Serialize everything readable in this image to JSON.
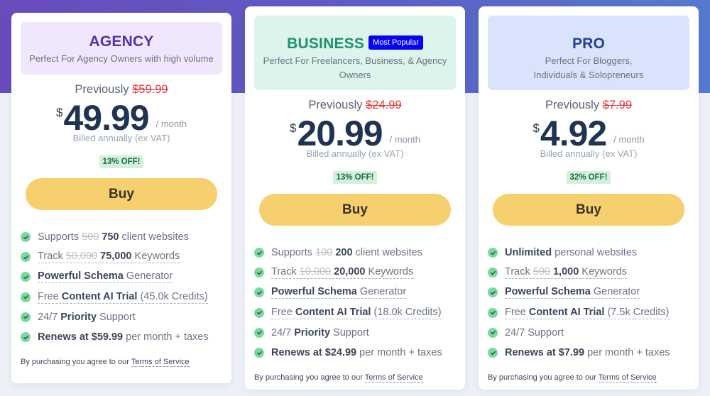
{
  "colors": {
    "hero_gradient_start": "#6a4bbd",
    "hero_gradient_end": "#557ad0",
    "buy_button": "#f6cf6e",
    "popular_badge": "#0505f0",
    "old_price": "#e23b3b",
    "check": "#7dd7a1",
    "off_badge_bg": "#d3f0dc"
  },
  "plans": [
    {
      "id": "agency",
      "title": "AGENCY",
      "badge": null,
      "description": "Perfect For Agency Owners with high volume",
      "previously_label": "Previously",
      "previous_price": "$59.99",
      "currency": "$",
      "price": "49.99",
      "period": "/ month",
      "billing": "Billed annually (ex VAT)",
      "discount": "13% OFF!",
      "buy_label": "Buy",
      "features": [
        {
          "icon": "check-circle-icon",
          "parts": [
            {
              "t": "Supports "
            },
            {
              "t": "500",
              "s": true
            },
            {
              "t": " "
            },
            {
              "t": "750",
              "b": true
            },
            {
              "t": " client websites"
            }
          ],
          "underline": false
        },
        {
          "icon": "check-circle-icon",
          "parts": [
            {
              "t": "Track "
            },
            {
              "t": "50,000",
              "s": true
            },
            {
              "t": " "
            },
            {
              "t": "75,000",
              "b": true
            },
            {
              "t": " Keywords"
            }
          ],
          "underline": true
        },
        {
          "icon": "check-circle-icon",
          "parts": [
            {
              "t": "Powerful Schema",
              "b": true
            },
            {
              "t": " Generator"
            }
          ],
          "underline": true
        },
        {
          "icon": "check-circle-icon",
          "parts": [
            {
              "t": "Free "
            },
            {
              "t": "Content AI Trial",
              "b": true
            },
            {
              "t": " (45.0k Credits)"
            }
          ],
          "underline": true
        },
        {
          "icon": "check-circle-icon",
          "parts": [
            {
              "t": "24/7 "
            },
            {
              "t": "Priority",
              "b": true
            },
            {
              "t": " Support"
            }
          ],
          "underline": false
        },
        {
          "icon": "check-circle-icon",
          "parts": [
            {
              "t": "Renews at $59.99",
              "b": true
            },
            {
              "t": " per month + taxes"
            }
          ],
          "underline": false
        }
      ],
      "terms_prefix": "By purchasing you agree to our ",
      "terms_link": "Terms of Service"
    },
    {
      "id": "business",
      "title": "BUSINESS",
      "badge": "Most Popular",
      "description": "Perfect For Freelancers, Business, & Agency Owners",
      "previously_label": "Previously",
      "previous_price": "$24.99",
      "currency": "$",
      "price": "20.99",
      "period": "/ month",
      "billing": "Billed annually (ex VAT)",
      "discount": "13% OFF!",
      "buy_label": "Buy",
      "features": [
        {
          "icon": "check-circle-icon",
          "parts": [
            {
              "t": "Supports "
            },
            {
              "t": "100",
              "s": true
            },
            {
              "t": " "
            },
            {
              "t": "200",
              "b": true
            },
            {
              "t": " client websites"
            }
          ],
          "underline": false
        },
        {
          "icon": "check-circle-icon",
          "parts": [
            {
              "t": "Track "
            },
            {
              "t": "10,000",
              "s": true
            },
            {
              "t": " "
            },
            {
              "t": "20,000",
              "b": true
            },
            {
              "t": " Keywords"
            }
          ],
          "underline": true
        },
        {
          "icon": "check-circle-icon",
          "parts": [
            {
              "t": "Powerful Schema",
              "b": true
            },
            {
              "t": " Generator"
            }
          ],
          "underline": true
        },
        {
          "icon": "check-circle-icon",
          "parts": [
            {
              "t": "Free "
            },
            {
              "t": "Content AI Trial",
              "b": true
            },
            {
              "t": " (18.0k Credits)"
            }
          ],
          "underline": true
        },
        {
          "icon": "check-circle-icon",
          "parts": [
            {
              "t": "24/7 "
            },
            {
              "t": "Priority",
              "b": true
            },
            {
              "t": " Support"
            }
          ],
          "underline": false
        },
        {
          "icon": "check-circle-icon",
          "parts": [
            {
              "t": "Renews at $24.99",
              "b": true
            },
            {
              "t": " per month + taxes"
            }
          ],
          "underline": false
        }
      ],
      "terms_prefix": "By purchasing you agree to our ",
      "terms_link": "Terms of Service"
    },
    {
      "id": "pro",
      "title": "PRO",
      "badge": null,
      "description": "Perfect For Bloggers, Individuals & Solopreneurs",
      "previously_label": "Previously",
      "previous_price": "$7.99",
      "currency": "$",
      "price": "4.92",
      "period": "/ month",
      "billing": "Billed annually (ex VAT)",
      "discount": "32% OFF!",
      "buy_label": "Buy",
      "features": [
        {
          "icon": "check-circle-icon",
          "parts": [
            {
              "t": "Unlimited",
              "b": true
            },
            {
              "t": " personal websites"
            }
          ],
          "underline": false
        },
        {
          "icon": "check-circle-icon",
          "parts": [
            {
              "t": "Track "
            },
            {
              "t": "500",
              "s": true
            },
            {
              "t": " "
            },
            {
              "t": "1,000",
              "b": true
            },
            {
              "t": " Keywords"
            }
          ],
          "underline": true
        },
        {
          "icon": "check-circle-icon",
          "parts": [
            {
              "t": "Powerful Schema",
              "b": true
            },
            {
              "t": " Generator"
            }
          ],
          "underline": true
        },
        {
          "icon": "check-circle-icon",
          "parts": [
            {
              "t": "Free "
            },
            {
              "t": "Content AI Trial",
              "b": true
            },
            {
              "t": " (7.5k Credits)"
            }
          ],
          "underline": true
        },
        {
          "icon": "check-circle-icon",
          "parts": [
            {
              "t": "24/7 Support"
            }
          ],
          "underline": false
        },
        {
          "icon": "check-circle-icon",
          "parts": [
            {
              "t": "Renews at $7.99",
              "b": true
            },
            {
              "t": " per month + taxes"
            }
          ],
          "underline": false
        }
      ],
      "terms_prefix": "By purchasing you agree to our ",
      "terms_link": "Terms of Service"
    }
  ]
}
